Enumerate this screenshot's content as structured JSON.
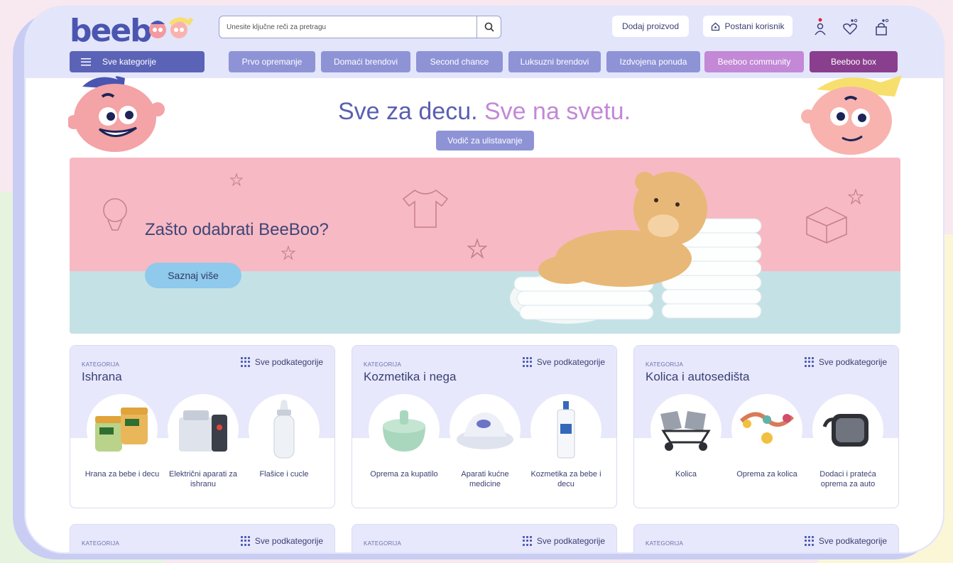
{
  "header": {
    "logo_text": "beeb",
    "search": {
      "placeholder": "Unesite ključne reči za pretragu"
    },
    "add_product_label": "Dodaj proizvod",
    "become_user_label": "Postani korisnik"
  },
  "nav": {
    "all_categories_label": "Sve kategorije",
    "items": [
      {
        "label": "Prvo opremanje"
      },
      {
        "label": "Domaći brendovi"
      },
      {
        "label": "Second chance"
      },
      {
        "label": "Luksuzni brendovi"
      },
      {
        "label": "Izdvojena ponuda"
      },
      {
        "label": "Beeboo community"
      },
      {
        "label": "Beeboo box"
      }
    ],
    "colors": {
      "default": "#8e93d6",
      "community": "#c388d6",
      "box": "#8a3f8e"
    }
  },
  "hero": {
    "title_part1": "Sve za decu.",
    "title_part2": "Sve na svetu.",
    "guide_button": "Vodič za ulistavanje"
  },
  "banner": {
    "title": "Zašto odabrati BeeBoo?",
    "cta": "Saznaj više"
  },
  "categories": [
    {
      "kicker": "KATEGORIJA",
      "title": "Ishrana",
      "all_label": "Sve podkategorije",
      "subs": [
        {
          "label": "Hrana za bebe i decu"
        },
        {
          "label": "Električni aparati za ishranu"
        },
        {
          "label": "Flašice i cucle"
        }
      ]
    },
    {
      "kicker": "KATEGORIJA",
      "title": "Kozmetika i nega",
      "all_label": "Sve podkategorije",
      "subs": [
        {
          "label": "Oprema za kupatilo"
        },
        {
          "label": "Aparati kućne medicine"
        },
        {
          "label": "Kozmetika za bebe i decu"
        }
      ]
    },
    {
      "kicker": "KATEGORIJA",
      "title": "Kolica i autosedišta",
      "all_label": "Sve podkategorije",
      "subs": [
        {
          "label": "Kolica"
        },
        {
          "label": "Oprema za kolica"
        },
        {
          "label": "Dodaci i prateća oprema za auto"
        }
      ]
    }
  ],
  "categories_row2": [
    {
      "kicker": "KATEGORIJA",
      "all_label": "Sve podkategorije"
    },
    {
      "kicker": "KATEGORIJA",
      "all_label": "Sve podkategorije"
    },
    {
      "kicker": "KATEGORIJA",
      "all_label": "Sve podkategorije"
    }
  ]
}
